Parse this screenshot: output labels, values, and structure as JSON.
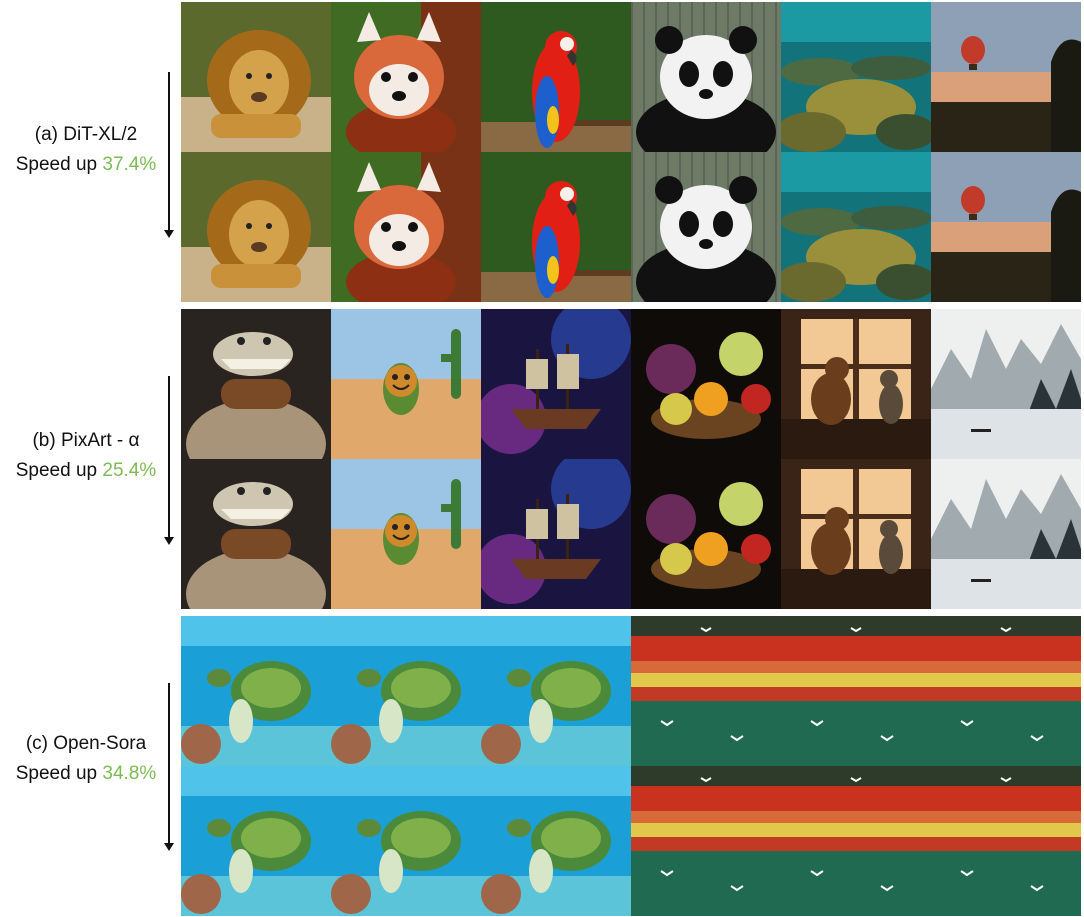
{
  "sections": [
    {
      "model": "(a) DiT-XL/2",
      "speed_label": "Speed up",
      "speed_value": "37.4%",
      "images": [
        "lion",
        "red-panda",
        "macaw-parrot",
        "panda",
        "coral-reef",
        "hot-air-balloon"
      ]
    },
    {
      "model": "(b) PixArt - α",
      "speed_label": "Speed up",
      "speed_value": "25.4%",
      "images": [
        "crocodile-in-sweater",
        "smiling-cactus",
        "galaxy-pirate-ship",
        "fruit-basket",
        "dog-and-cat-at-window",
        "ink-landscape"
      ]
    },
    {
      "model": "(c) Open-Sora",
      "speed_label": "Speed up",
      "speed_value": "34.8%",
      "images": [
        "sea-turtle",
        "sea-turtle",
        "sea-turtle",
        "cliff-with-seabirds",
        "cliff-with-seabirds",
        "cliff-with-seabirds"
      ]
    }
  ],
  "colors": {
    "speed_value": "#7dbb52",
    "text": "#111111"
  }
}
